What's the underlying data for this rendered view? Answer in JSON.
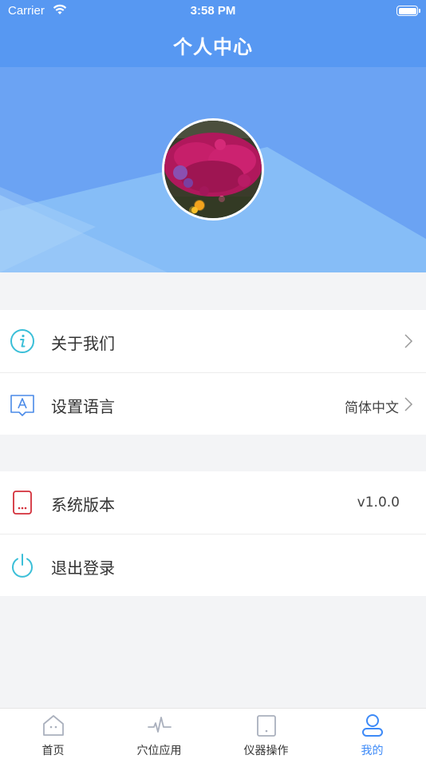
{
  "status_bar": {
    "carrier": "Carrier",
    "time": "3:58 PM"
  },
  "header": {
    "title": "个人中心"
  },
  "colors": {
    "brand": "#5798f2",
    "accent_active": "#3d8af7",
    "icon_cyan": "#3bbfd8",
    "icon_red": "#d32f3a"
  },
  "menu": {
    "about": {
      "label": "关于我们",
      "icon": "info-icon"
    },
    "language": {
      "label": "设置语言",
      "value": "简体中文",
      "icon": "language-icon"
    },
    "version": {
      "label": "系统版本",
      "value": "v1.0.0",
      "icon": "phone-icon"
    },
    "logout": {
      "label": "退出登录",
      "icon": "power-icon"
    }
  },
  "tabs": [
    {
      "label": "首页",
      "icon": "home-icon",
      "active": false
    },
    {
      "label": "穴位应用",
      "icon": "pulse-icon",
      "active": false
    },
    {
      "label": "仪器操作",
      "icon": "device-icon",
      "active": false
    },
    {
      "label": "我的",
      "icon": "user-icon",
      "active": true
    }
  ]
}
